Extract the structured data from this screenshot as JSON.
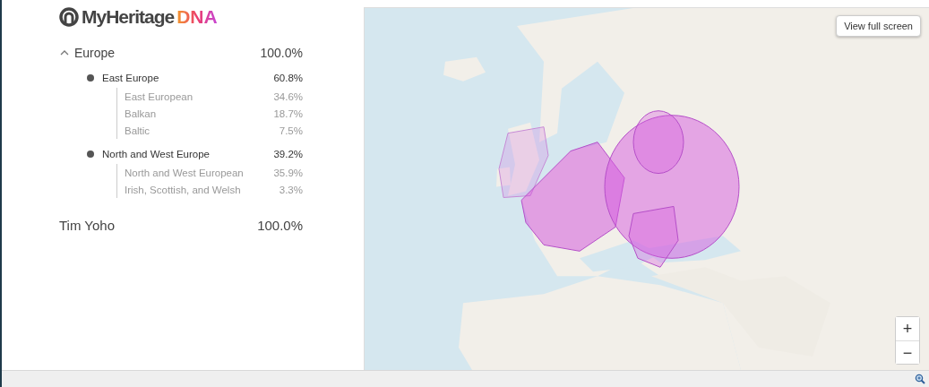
{
  "logo": {
    "name": "MyHeritage",
    "product": "DNA"
  },
  "ethnicity": [
    {
      "label": "Europe",
      "percent": "100.0%",
      "expanded": true,
      "children": [
        {
          "label": "East Europe",
          "percent": "60.8%",
          "children": [
            {
              "label": "East European",
              "percent": "34.6%"
            },
            {
              "label": "Balkan",
              "percent": "18.7%"
            },
            {
              "label": "Baltic",
              "percent": "7.5%"
            }
          ]
        },
        {
          "label": "North and West Europe",
          "percent": "39.2%",
          "children": [
            {
              "label": "North and West European",
              "percent": "35.9%"
            },
            {
              "label": "Irish, Scottish, and Welsh",
              "percent": "3.3%"
            }
          ]
        }
      ]
    }
  ],
  "total": {
    "name": "Tim Yoho",
    "percent": "100.0%"
  },
  "map": {
    "kind": "picture",
    "full_screen_button": "View full screen",
    "zoom_in": "+",
    "zoom_out": "−"
  }
}
